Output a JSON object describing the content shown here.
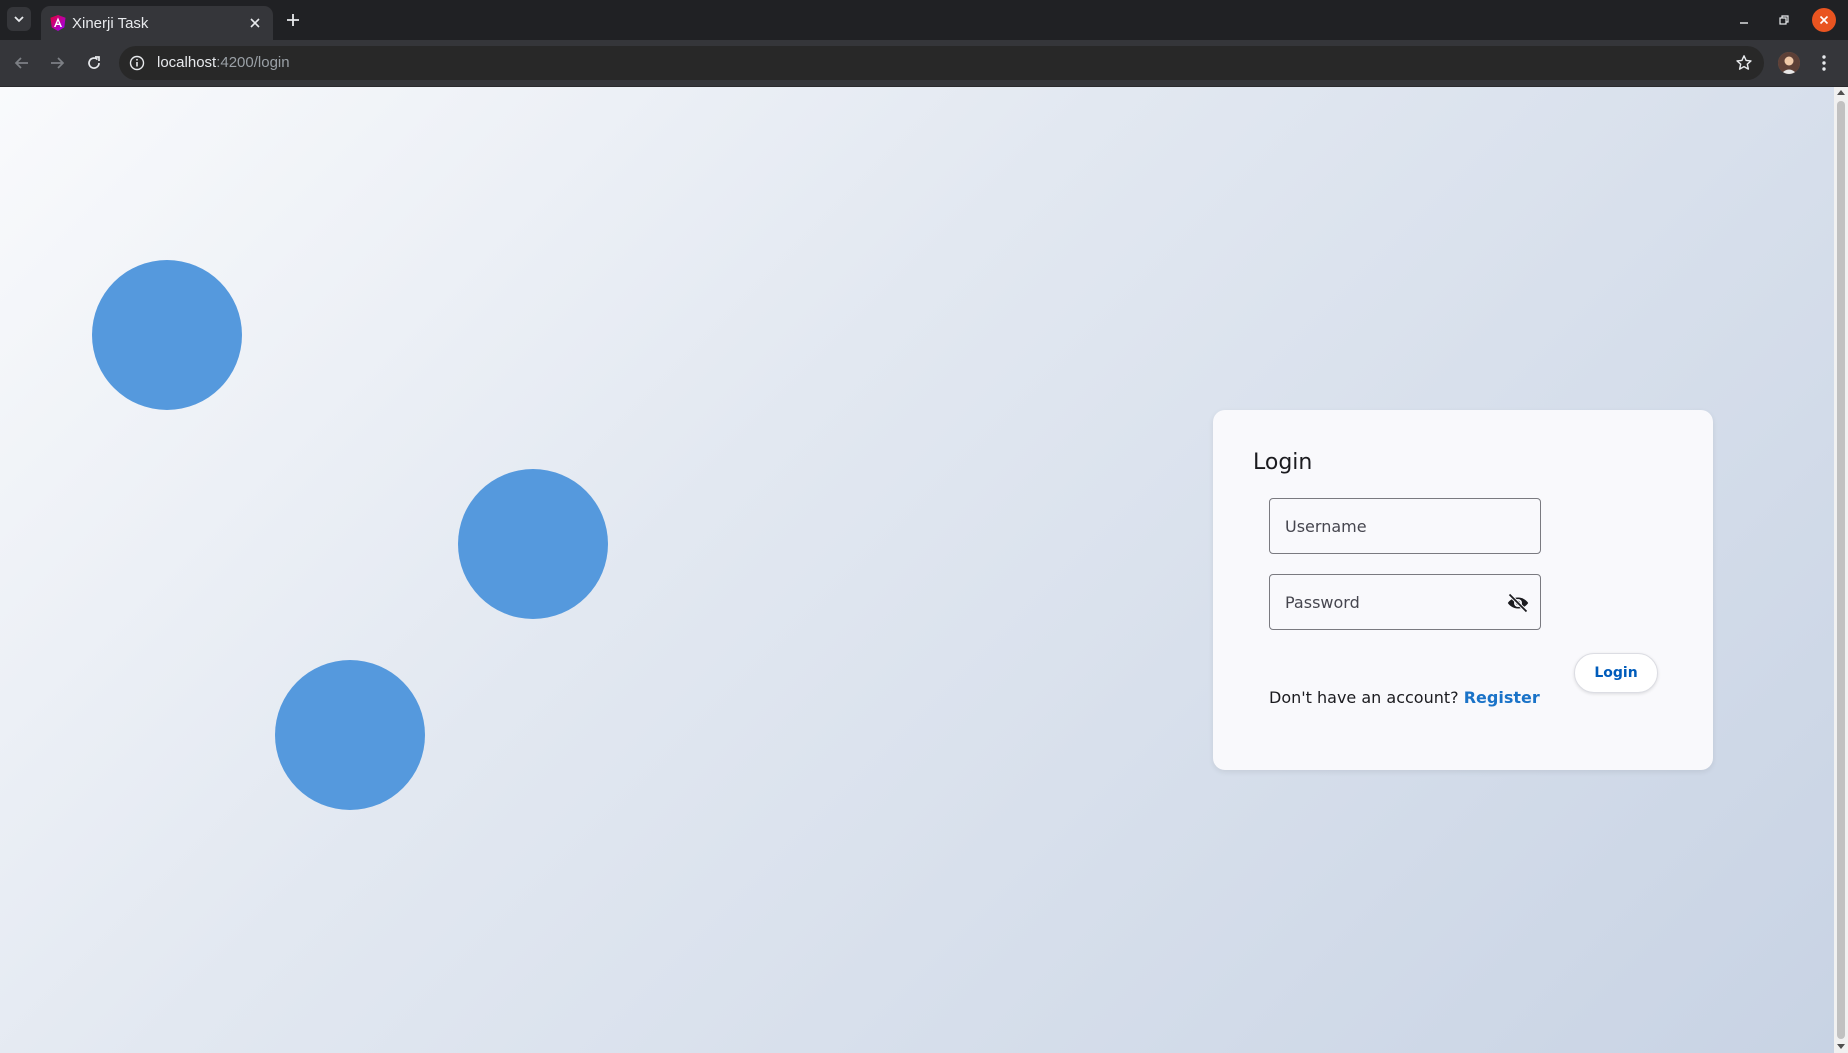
{
  "browser": {
    "tab": {
      "title": "Xinerji Task",
      "favicon": "angular-logo-icon"
    },
    "url": {
      "host": "localhost",
      "rest": ":4200/login"
    },
    "icons": {
      "tab_search": "chevron-down-icon",
      "tab_close": "close-icon",
      "new_tab": "plus-icon",
      "back": "arrow-left-icon",
      "forward": "arrow-right-icon",
      "reload": "reload-icon",
      "site_info": "info-icon",
      "bookmark": "star-icon",
      "menu": "kebab-menu-icon"
    }
  },
  "login": {
    "title": "Login",
    "username_placeholder": "Username",
    "password_placeholder": "Password",
    "password_toggle_icon": "visibility-off-icon",
    "button_label": "Login",
    "register_prompt": "Don't have an account?",
    "register_link": "Register"
  },
  "colors": {
    "circle": "#5599dd",
    "primary_link": "#1a73c8",
    "button_text": "#005cbb",
    "window_close": "#e95420"
  }
}
